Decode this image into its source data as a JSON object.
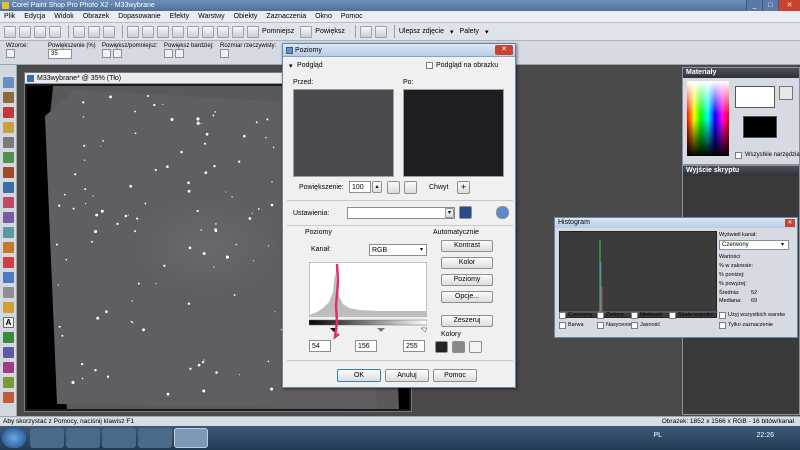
{
  "app": {
    "title": "Corel Paint Shop Pro Photo X2 - M33wybrane",
    "win_min": "_",
    "win_max": "□",
    "win_close": "✕"
  },
  "menu": [
    "Plik",
    "Edycja",
    "Widok",
    "Obrazek",
    "Dopasowanie",
    "Efekty",
    "Warstwy",
    "Obiekty",
    "Zaznaczenia",
    "Okno",
    "Pomoc"
  ],
  "menu_right": {
    "improve": "Ulepsz zdjęcie",
    "palettes": "Palety"
  },
  "toolbar": {
    "zoom_in": "Pomniejsz",
    "zoom_out": "Powiększ"
  },
  "tool_options": {
    "preset": "Wzorce:",
    "zoom_percent_label": "Powiększenie (%)",
    "zoom_percent_value": "35",
    "zoom_inout_label": "Powiększ/pomniejsz:",
    "zoom_more_label": "Powiększ bardziej:",
    "actual_size_label": "Rozmiar rzeczywisty:"
  },
  "document": {
    "title": "M33wybrane* @  35% (Tło)"
  },
  "materials": {
    "title": "Materiały",
    "all_tools": "Wszystkie narzędzia"
  },
  "scripts": {
    "title": "Wyjście skryptu"
  },
  "dialog": {
    "title": "Poziomy",
    "preview_tab": "Podgląd",
    "preview_on_image": "Podgląd na obrazku",
    "before": "Przed:",
    "after": "Po:",
    "zoom_label": "Powiększenie:",
    "zoom_value": "100",
    "pan_label": "Chwyt",
    "settings_label": "Ustawienia:",
    "levels_group": "Poziomy",
    "channel_label": "Kanał:",
    "channel_value": "RGB",
    "auto_group": "Automatycznie",
    "btn_contrast": "Kontrast",
    "btn_color": "Kolor",
    "btn_levels": "Poziomy",
    "btn_options": "Opcje...",
    "btn_reset": "Zeszeruj",
    "colors_label": "Kolory",
    "input_black": "54",
    "input_gamma": "156",
    "input_white": "255",
    "ok": "OK",
    "cancel": "Anuluj",
    "help": "Pomoc"
  },
  "histogram": {
    "title": "Histogram",
    "channel_label": "Wyświetl kanał:",
    "channel_value": "Czerwony",
    "values_label": "Wartości",
    "in_range": "% w zakresie:",
    "below": "% poniżej:",
    "above": "% powyżej:",
    "mean_label": "Średnia:",
    "mean_value": "52",
    "median_label": "Mediana:",
    "median_value": "69",
    "cb_red": "Czerwony",
    "cb_green": "Zielony",
    "cb_blue": "Niebieski",
    "cb_gray": "Skala szarości",
    "cb_all_layers": "Użyj wszystkich warstw",
    "cb_hue": "Barwa",
    "cb_saturation": "Nasycenie",
    "cb_brightness": "Jasność",
    "cb_selection_only": "Tylko zaznaczenie"
  },
  "status": {
    "left": "Aby skorzystać z Pomocy, naciśnij klawisz F1",
    "right": "Obrazek:  1852 x 1566 x RGB - 16 bitów/kanał"
  },
  "taskbar": {
    "lang": "PL",
    "clock": "22:26"
  }
}
